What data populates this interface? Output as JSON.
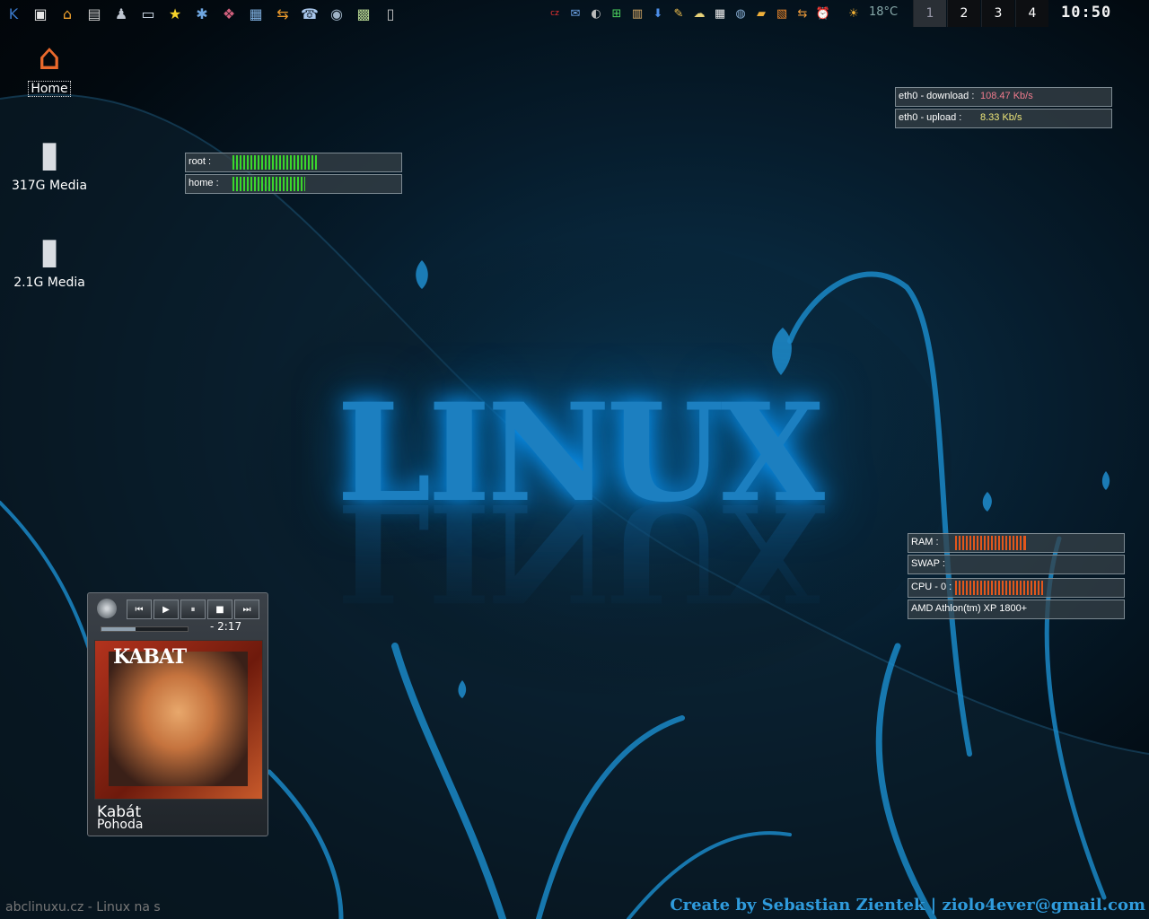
{
  "panel": {
    "launchers": [
      {
        "icon": "kde-menu-icon",
        "glyph": "K",
        "color": "#3b79c9"
      },
      {
        "icon": "show-desktop-icon",
        "glyph": "▣",
        "color": "#e8e8e8"
      },
      {
        "icon": "home-folder-icon",
        "glyph": "⌂",
        "color": "#f2a22d"
      },
      {
        "icon": "printer-icon",
        "glyph": "▤",
        "color": "#cfcfcf"
      },
      {
        "icon": "gamepad-icon",
        "glyph": "♟",
        "color": "#bfc6d1"
      },
      {
        "icon": "terminal-icon",
        "glyph": "▭",
        "color": "#d6e2f0"
      },
      {
        "icon": "bookmarks-star-icon",
        "glyph": "★",
        "color": "#f6d32a"
      },
      {
        "icon": "network-tool-icon",
        "glyph": "✱",
        "color": "#6ea6e0"
      },
      {
        "icon": "archiver-icon",
        "glyph": "❖",
        "color": "#d1607d"
      },
      {
        "icon": "video-player-icon",
        "glyph": "▦",
        "color": "#7fb0e0"
      },
      {
        "icon": "download-manager-icon",
        "glyph": "⇆",
        "color": "#ec9b2c"
      },
      {
        "icon": "messenger-icon",
        "glyph": "☎",
        "color": "#a9c7ec"
      },
      {
        "icon": "disc-burner-icon",
        "glyph": "◉",
        "color": "#9fb3c6"
      },
      {
        "icon": "image-viewer-icon",
        "glyph": "▩",
        "color": "#b2d18f"
      },
      {
        "icon": "trash-icon",
        "glyph": "▯",
        "color": "#c6c6c6"
      }
    ],
    "tray": [
      {
        "icon": "keyboard-layout-cz-icon",
        "glyph": "cz",
        "color": "#e33"
      },
      {
        "icon": "email-icon",
        "glyph": "✉",
        "color": "#6fa6ea"
      },
      {
        "icon": "disk-icon",
        "glyph": "◐",
        "color": "#bbb"
      },
      {
        "icon": "network-status-icon",
        "glyph": "⊞",
        "color": "#4bd15e"
      },
      {
        "icon": "package-manager-icon",
        "glyph": "▥",
        "color": "#e0b06a"
      },
      {
        "icon": "download-arrow-icon",
        "glyph": "⬇",
        "color": "#4c8ee8"
      },
      {
        "icon": "notes-icon",
        "glyph": "✎",
        "color": "#f2c14e"
      },
      {
        "icon": "chat-icon",
        "glyph": "☁",
        "color": "#e8d27a"
      },
      {
        "icon": "clipboard-icon",
        "glyph": "▦",
        "color": "#f0f0f0"
      },
      {
        "icon": "globe-icon",
        "glyph": "◍",
        "color": "#8ab1d6"
      },
      {
        "icon": "folder-icon",
        "glyph": "▰",
        "color": "#f0b03a"
      },
      {
        "icon": "wallet-icon",
        "glyph": "▧",
        "color": "#f08a2c"
      },
      {
        "icon": "transfer-icon",
        "glyph": "⇆",
        "color": "#ef9c3a"
      },
      {
        "icon": "alarm-clock-icon",
        "glyph": "⏰",
        "color": "#ececec"
      },
      {
        "icon": "weather-sun-icon",
        "glyph": "☀",
        "color": "#f3b235"
      }
    ],
    "temperature": "18°C",
    "desktops": [
      "1",
      "2",
      "3",
      "4"
    ],
    "active_desktop": "1",
    "clock": "10:50"
  },
  "desktop_icons": [
    {
      "label": "Home",
      "icon": "home-icon",
      "glyph": "⌂",
      "selected": true
    },
    {
      "label": "317G Media",
      "icon": "usb-drive-mounted-icon",
      "glyph": "▮",
      "selected": false
    },
    {
      "label": "2.1G Media",
      "icon": "usb-drive-icon",
      "glyph": "▮",
      "selected": false
    }
  ],
  "disk_meters": [
    {
      "label": "root :",
      "fraction": 0.43
    },
    {
      "label": "home :",
      "fraction": 0.37
    }
  ],
  "network_meters": [
    {
      "label": "eth0 - download :",
      "value": "108.47 Kb/s",
      "color": "#f07b8d"
    },
    {
      "label": "eth0 - upload :",
      "value": "8.33 Kb/s",
      "color": "#f0e87a"
    }
  ],
  "system_meters": [
    {
      "label": "RAM :",
      "fraction": 0.42
    },
    {
      "label": "SWAP :",
      "fraction": 0.0
    },
    {
      "label": "CPU - 0 :",
      "fraction": 0.52
    }
  ],
  "cpu_model": "AMD Athlon(tm) XP 1800+",
  "player": {
    "time": "- 2:17",
    "progress": 0.4,
    "artist": "Kabát",
    "title": "Pohoda",
    "cover_text": "KABAT",
    "buttons": [
      {
        "name": "previous-button",
        "glyph": "⏮"
      },
      {
        "name": "play-button",
        "glyph": "▶"
      },
      {
        "name": "pause-button",
        "glyph": "⏸"
      },
      {
        "name": "stop-button",
        "glyph": "■"
      },
      {
        "name": "next-button",
        "glyph": "⏭"
      }
    ]
  },
  "wallpaper": {
    "logo": "LINUX",
    "credit": "Create by Sebastian Zientek | ziolo4ever@gmail.com",
    "accent": "#1c7fc0"
  },
  "taskbar": {
    "entry": "abclinuxu.cz - Linux na s"
  }
}
